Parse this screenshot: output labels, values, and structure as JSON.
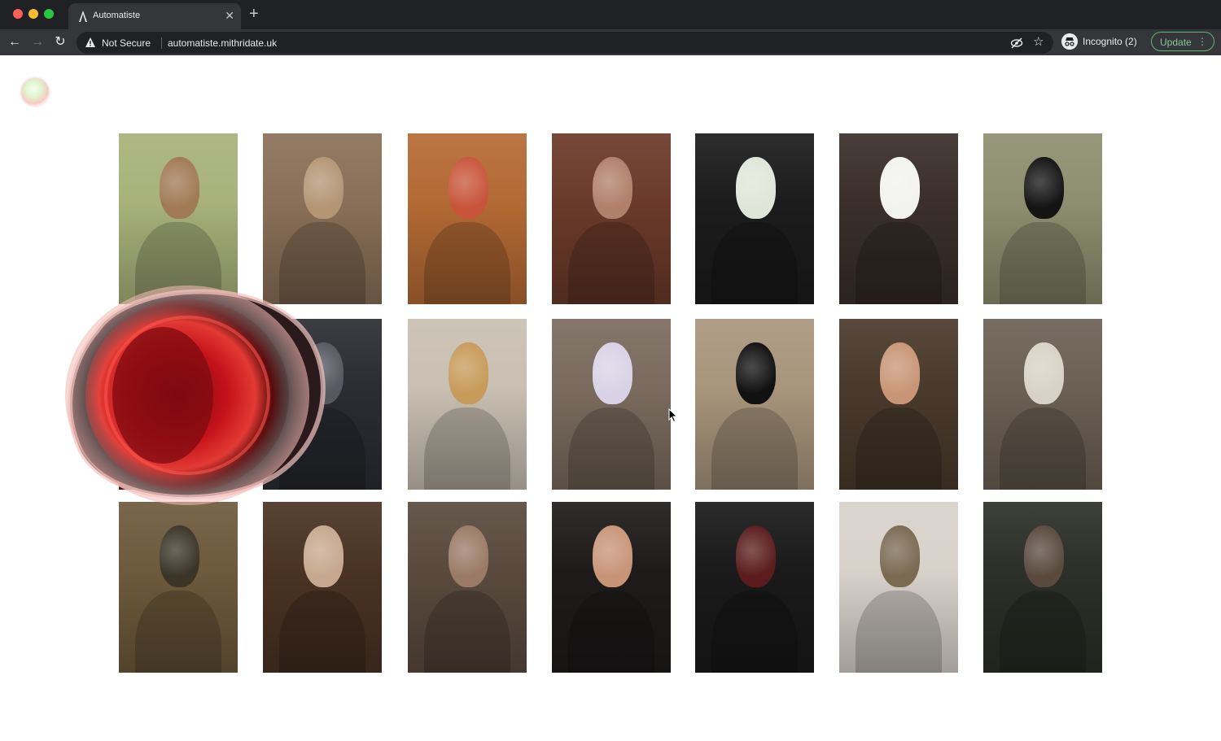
{
  "browser": {
    "tab_title": "Automatiste",
    "tab_close": "✕",
    "new_tab": "+",
    "security_label": "Not Secure",
    "url": "automatiste.mithridate.uk",
    "profile_label": "Incognito (2)",
    "update_label": "Update",
    "nav": {
      "back": "←",
      "forward": "→",
      "reload": "↻",
      "star": "☆",
      "menu": "⋮"
    }
  },
  "colors": {
    "chrome_dark": "#202124",
    "chrome_toolbar": "#35363a",
    "update_green": "#81c995",
    "page_bg": "#ffffff",
    "accent_red": "#c4121a"
  },
  "gallery": {
    "rows": [
      [
        {
          "name": "portrait-1-1",
          "bg": "#a8b27a",
          "face": "#a07a55"
        },
        {
          "name": "portrait-1-2",
          "bg": "#8a7058",
          "face": "#b49674"
        },
        {
          "name": "portrait-1-3",
          "bg": "#b46a34",
          "face": "#c8553a"
        },
        {
          "name": "portrait-1-4",
          "bg": "#6b3a2a",
          "face": "#b0806a"
        },
        {
          "name": "portrait-1-5",
          "bg": "#1c1c1c",
          "face": "#dfe6d8"
        },
        {
          "name": "portrait-1-6",
          "bg": "#3a2f2a",
          "face": "#f2f2ee"
        },
        {
          "name": "portrait-1-7",
          "bg": "#8e8e70",
          "face": "#141414"
        }
      ],
      [
        {
          "name": "portrait-2-1",
          "bg": "#6a1a1a",
          "face": "#2a0c0c"
        },
        {
          "name": "portrait-2-2",
          "bg": "#2b2d33",
          "face": "#555860"
        },
        {
          "name": "portrait-2-3",
          "bg": "#c9bfb2",
          "face": "#c79b5a"
        },
        {
          "name": "portrait-2-4",
          "bg": "#7a6b5e",
          "face": "#d9d2e6"
        },
        {
          "name": "portrait-2-5",
          "bg": "#a8957c",
          "face": "#111111"
        },
        {
          "name": "portrait-2-6",
          "bg": "#4a3a2c",
          "face": "#c89676"
        },
        {
          "name": "portrait-2-7",
          "bg": "#6c6054",
          "face": "#d8d2c6"
        }
      ],
      [
        {
          "name": "portrait-3-1",
          "bg": "#6e5a3c",
          "face": "#3b3528"
        },
        {
          "name": "portrait-3-2",
          "bg": "#4a3324",
          "face": "#c6a88e"
        },
        {
          "name": "portrait-3-3",
          "bg": "#5a4a3e",
          "face": "#9a7a66"
        },
        {
          "name": "portrait-3-4",
          "bg": "#1f1b1b",
          "face": "#c89478"
        },
        {
          "name": "portrait-3-5",
          "bg": "#1a1a1a",
          "face": "#5a1c1c"
        },
        {
          "name": "portrait-3-6",
          "bg": "#d8d2cb",
          "face": "#7a6a52"
        },
        {
          "name": "portrait-3-7",
          "bg": "#2c3028",
          "face": "#5a4a3e"
        }
      ]
    ]
  }
}
